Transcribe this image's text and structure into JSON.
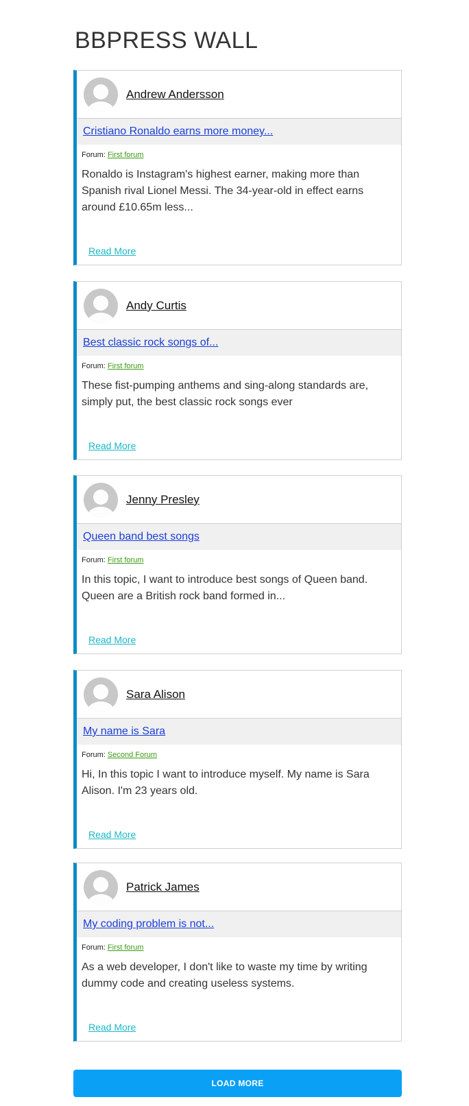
{
  "page_title": "BBPRESS WALL",
  "forum_prefix": "Forum:",
  "read_more_label": "Read More",
  "load_more_label": "LOAD MORE",
  "posts": [
    {
      "author": "Andrew Andersson",
      "topic": "Cristiano Ronaldo earns more money...",
      "forum": "First forum",
      "excerpt": "Ronaldo is Instagram's highest earner, making more than Spanish rival Lionel Messi. The 34-year-old in effect earns around £10.65m less..."
    },
    {
      "author": "Andy Curtis",
      "topic": "Best classic rock songs of...",
      "forum": "First forum",
      "excerpt": "These fist-pumping anthems and sing-along standards are, simply put, the best classic rock songs ever"
    },
    {
      "author": "Jenny Presley",
      "topic": "Queen band best songs",
      "forum": "First forum",
      "excerpt": "In this topic, I want to introduce best songs of Queen band. Queen are a British rock band formed in..."
    },
    {
      "author": "Sara Alison",
      "topic": "My name is Sara",
      "forum": "Second Forum",
      "excerpt": "Hi, In this topic I want to introduce myself. My name is Sara Alison. I'm 23 years old."
    },
    {
      "author": "Patrick James",
      "topic": "My coding problem is not...",
      "forum": "First forum",
      "excerpt": "As a web developer, I don't like to waste my time by writing dummy code and creating useless systems."
    }
  ],
  "colors": {
    "accent_border": "#0b8bc7",
    "topic_link": "#1a3fd8",
    "forum_link": "#3c9a14",
    "read_more": "#1bb8c6",
    "load_more_button": "#0aa0f5"
  }
}
